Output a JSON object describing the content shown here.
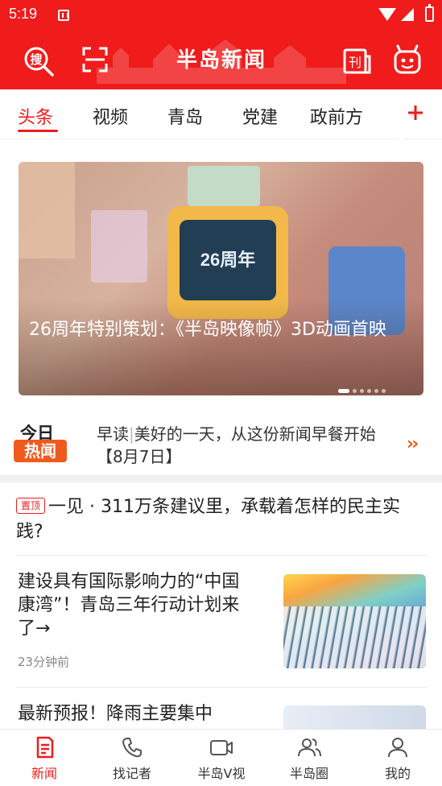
{
  "status_bar": {
    "time": "5:19"
  },
  "header": {
    "logo_text": "半岛新闻",
    "search_icon": "search-icon",
    "scan_icon": "scan-icon",
    "paper_icon": "newspaper-icon",
    "mascot_icon": "mascot-icon",
    "paper_glyph": "刊",
    "search_glyph": "搜",
    "brand_color": "#f01b1b"
  },
  "tabs": {
    "items": [
      {
        "label": "头条",
        "active": true
      },
      {
        "label": "视频"
      },
      {
        "label": "青岛"
      },
      {
        "label": "党建"
      },
      {
        "label": "政前方"
      }
    ],
    "add_icon": "plus-icon"
  },
  "banner": {
    "screen_text": "26周年",
    "caption": "26周年特别策划：《半岛映像帧》3D动画首映",
    "slide_count": 6,
    "active_slide": 1
  },
  "hot_news": {
    "badge_top": "今日",
    "badge_bottom": "热闻",
    "prefix": "早读",
    "separator": "|",
    "headline": "美好的一天，从这份新闻早餐开始【8月7日】",
    "arrow_glyph": "››"
  },
  "pinned": {
    "tag": "置顶",
    "title": "一见 · 311万条建议里，承载着怎样的民主实践?"
  },
  "articles": [
    {
      "title": "建设具有国际影响力的“中国康湾”！青岛三年行动计划来了→",
      "time": "23分钟前"
    },
    {
      "title": "最新预报！降雨主要集中"
    }
  ],
  "bottom_nav": [
    {
      "label": "新闻",
      "icon": "news-icon",
      "active": true
    },
    {
      "label": "找记者",
      "icon": "phone-icon"
    },
    {
      "label": "半岛V视",
      "icon": "video-icon"
    },
    {
      "label": "半岛圈",
      "icon": "community-icon"
    },
    {
      "label": "我的",
      "icon": "profile-icon"
    }
  ]
}
